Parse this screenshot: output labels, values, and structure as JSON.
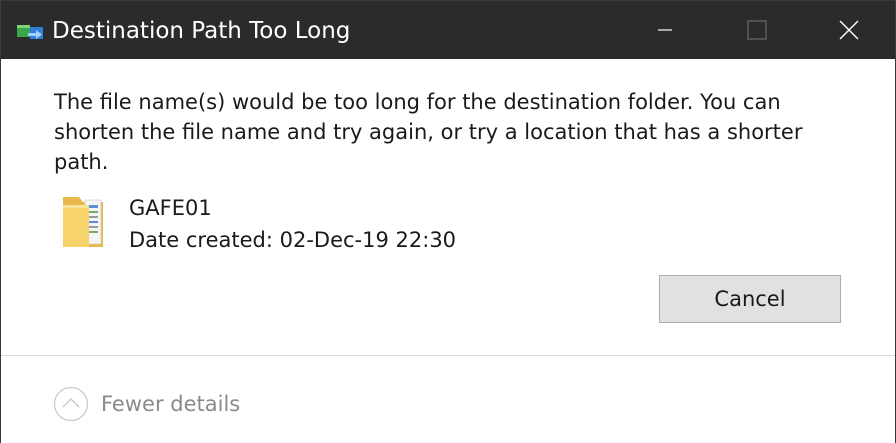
{
  "window": {
    "title": "Destination Path Too Long"
  },
  "titlebar": {
    "minimize_icon": "minimize-icon",
    "maximize_icon": "maximize-icon",
    "close_icon": "close-icon"
  },
  "message": "The file name(s) would be too long for the destination folder. You can shorten the file name and try again, or try a location that has a shorter path.",
  "file": {
    "icon": "folder-icon",
    "name": "GAFE01",
    "date_created": "Date created: 02-Dec-19 22:30"
  },
  "buttons": {
    "cancel_label": "Cancel"
  },
  "footer": {
    "toggle_icon": "chevron-up-circle-icon",
    "toggle_label": "Fewer details"
  },
  "colors": {
    "titlebar_bg": "#2b2b2b",
    "button_bg": "#e1e1e1",
    "button_border": "#adadad",
    "muted_text": "#8a8a8a"
  }
}
